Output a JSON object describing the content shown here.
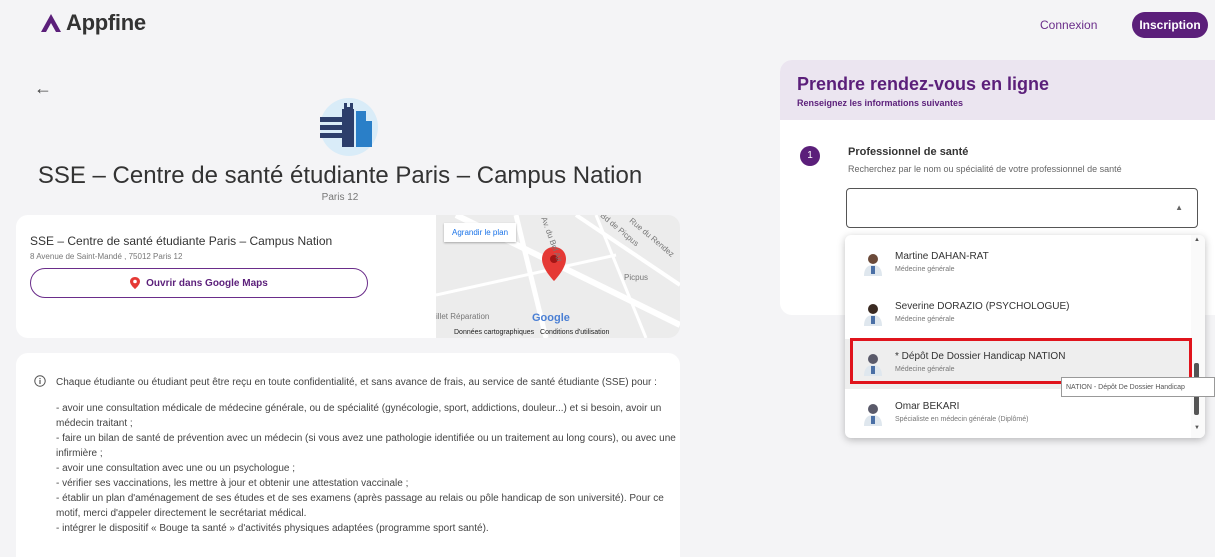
{
  "header": {
    "logo_text": "Appfine",
    "connexion_label": "Connexion",
    "inscription_label": "Inscription",
    "brand_color": "#5b1f7a"
  },
  "center": {
    "title": "SSE – Centre de santé étudiante Paris – Campus Nation",
    "subtitle": "Paris 12"
  },
  "location": {
    "name": "SSE – Centre de santé étudiante Paris – Campus Nation",
    "address": "8 Avenue de Saint-Mandé , 75012 Paris 12",
    "maps_button_label": "Ouvrir dans Google Maps"
  },
  "map": {
    "enlarge_label": "Agrandir le plan",
    "labels": {
      "bd_picpus": "Bd de Picpus",
      "rue_rendez": "Rue du Rendez",
      "picpus": "Picpus",
      "reparation": "illet Réparation",
      "av_bel_air": "Av. du Bel Air"
    },
    "google_label": "Google",
    "footer_data": "Données cartographiques",
    "footer_terms": "Conditions d'utilisation"
  },
  "description": {
    "intro": "Chaque étudiante ou étudiant peut être reçu en toute confidentialité, et sans avance de frais, au service de santé étudiante (SSE) pour :",
    "items": [
      "- avoir une consultation médicale de médecine générale, ou de spécialité (gynécologie, sport, addictions, douleur...) et si besoin, avoir un médecin traitant ;",
      "- faire un bilan de santé de prévention avec un médecin (si vous avez une pathologie identifiée ou un traitement au long cours), ou avec une infirmière ;",
      "- avoir une consultation avec une ou un psychologue ;",
      "- vérifier ses vaccinations, les mettre à jour et obtenir une attestation vaccinale ;",
      "- établir un plan d'aménagement de ses études et de ses examens (après passage au relais ou pôle handicap de son université). Pour ce motif, merci d'appeler directement le secrétariat médical.",
      "- intégrer le dispositif « Bouge ta santé » d'activités physiques adaptées (programme sport santé)."
    ]
  },
  "booking": {
    "title": "Prendre rendez-vous en ligne",
    "subtitle": "Renseignez les informations suivantes",
    "step_number": "1",
    "step_label": "Professionnel de santé",
    "step_hint": "Recherchez par le nom ou spécialité de votre professionnel de santé",
    "search_value": ""
  },
  "dropdown": {
    "items": [
      {
        "name": "Martine DAHAN-RAT",
        "specialty": "Médecine générale"
      },
      {
        "name": "Severine DORAZIO (PSYCHOLOGUE)",
        "specialty": "Médecine générale"
      },
      {
        "name": "* Dépôt De Dossier Handicap NATION",
        "specialty": "Médecine générale"
      },
      {
        "name": "Omar BEKARI",
        "specialty": "Spécialiste en médecin générale (Diplômé)"
      }
    ],
    "highlighted_index": 2,
    "tooltip": "NATION - Dépôt De Dossier Handicap"
  },
  "colors": {
    "highlight_border": "#e0141c",
    "map_pin": "#e53935"
  }
}
